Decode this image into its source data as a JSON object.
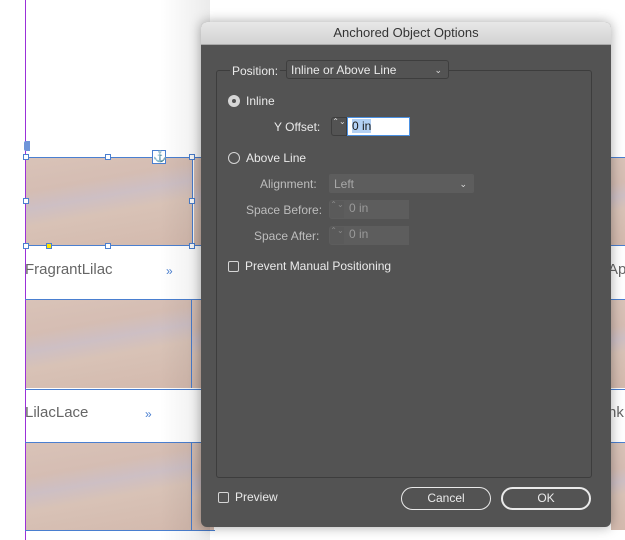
{
  "document": {
    "items": [
      {
        "caption": "FragrantLilac",
        "link_glyph": "»"
      },
      {
        "caption": "LilacLace",
        "link_glyph": "»"
      }
    ],
    "right_column_captions": [
      "Ap",
      "nk"
    ],
    "anchor_glyph": "⚓"
  },
  "dialog": {
    "title": "Anchored Object Options",
    "position": {
      "label": "Position:",
      "value": "Inline or Above Line"
    },
    "inline": {
      "label": "Inline",
      "selected": true,
      "y_offset": {
        "label": "Y Offset:",
        "value": "0 in"
      }
    },
    "above_line": {
      "label": "Above Line",
      "selected": false,
      "alignment": {
        "label": "Alignment:",
        "value": "Left"
      },
      "space_before": {
        "label": "Space Before:",
        "value": "0 in"
      },
      "space_after": {
        "label": "Space After:",
        "value": "0 in"
      }
    },
    "prevent_manual_positioning": {
      "label": "Prevent Manual Positioning",
      "checked": false
    },
    "preview": {
      "label": "Preview",
      "checked": false
    },
    "buttons": {
      "cancel": "Cancel",
      "ok": "OK"
    },
    "icons": {
      "chevron": "⌄",
      "stepper": "⌃⌄"
    }
  }
}
